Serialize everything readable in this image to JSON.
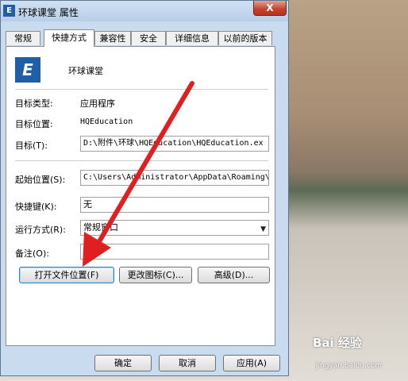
{
  "window": {
    "title": "环球课堂 属性",
    "app_icon_glyph": "E",
    "close_glyph": "X"
  },
  "tabs": [
    {
      "label": "常规"
    },
    {
      "label": "快捷方式",
      "active": true
    },
    {
      "label": "兼容性"
    },
    {
      "label": "安全"
    },
    {
      "label": "详细信息"
    },
    {
      "label": "以前的版本"
    }
  ],
  "shortcut": {
    "icon_glyph": "E",
    "name": "环球课堂"
  },
  "fields": {
    "target_type_label": "目标类型:",
    "target_type_value": "应用程序",
    "target_location_label": "目标位置:",
    "target_location_value": "HQEducation",
    "target_label": "目标(T):",
    "target_value": "D:\\附件\\环球\\HQEducation\\HQEducation.ex",
    "start_in_label": "起始位置(S):",
    "start_in_value": "C:\\Users\\Administrator\\AppData\\Roaming\\",
    "hotkey_label": "快捷键(K):",
    "hotkey_value": "无",
    "run_label": "运行方式(R):",
    "run_value": "常规窗口",
    "comment_label": "备注(O):",
    "comment_value": ""
  },
  "buttons": {
    "open_location": "打开文件位置(F)",
    "change_icon": "更改图标(C)...",
    "advanced": "高级(D)...",
    "ok": "确定",
    "cancel": "取消",
    "apply": "应用(A)"
  },
  "watermark": {
    "brand": "Bai 经验",
    "site": "jingyan.baidu.com"
  },
  "colors": {
    "window_frame": "#c9dbee",
    "close_button": "#c4412b",
    "annotation_arrow": "#e02020"
  }
}
